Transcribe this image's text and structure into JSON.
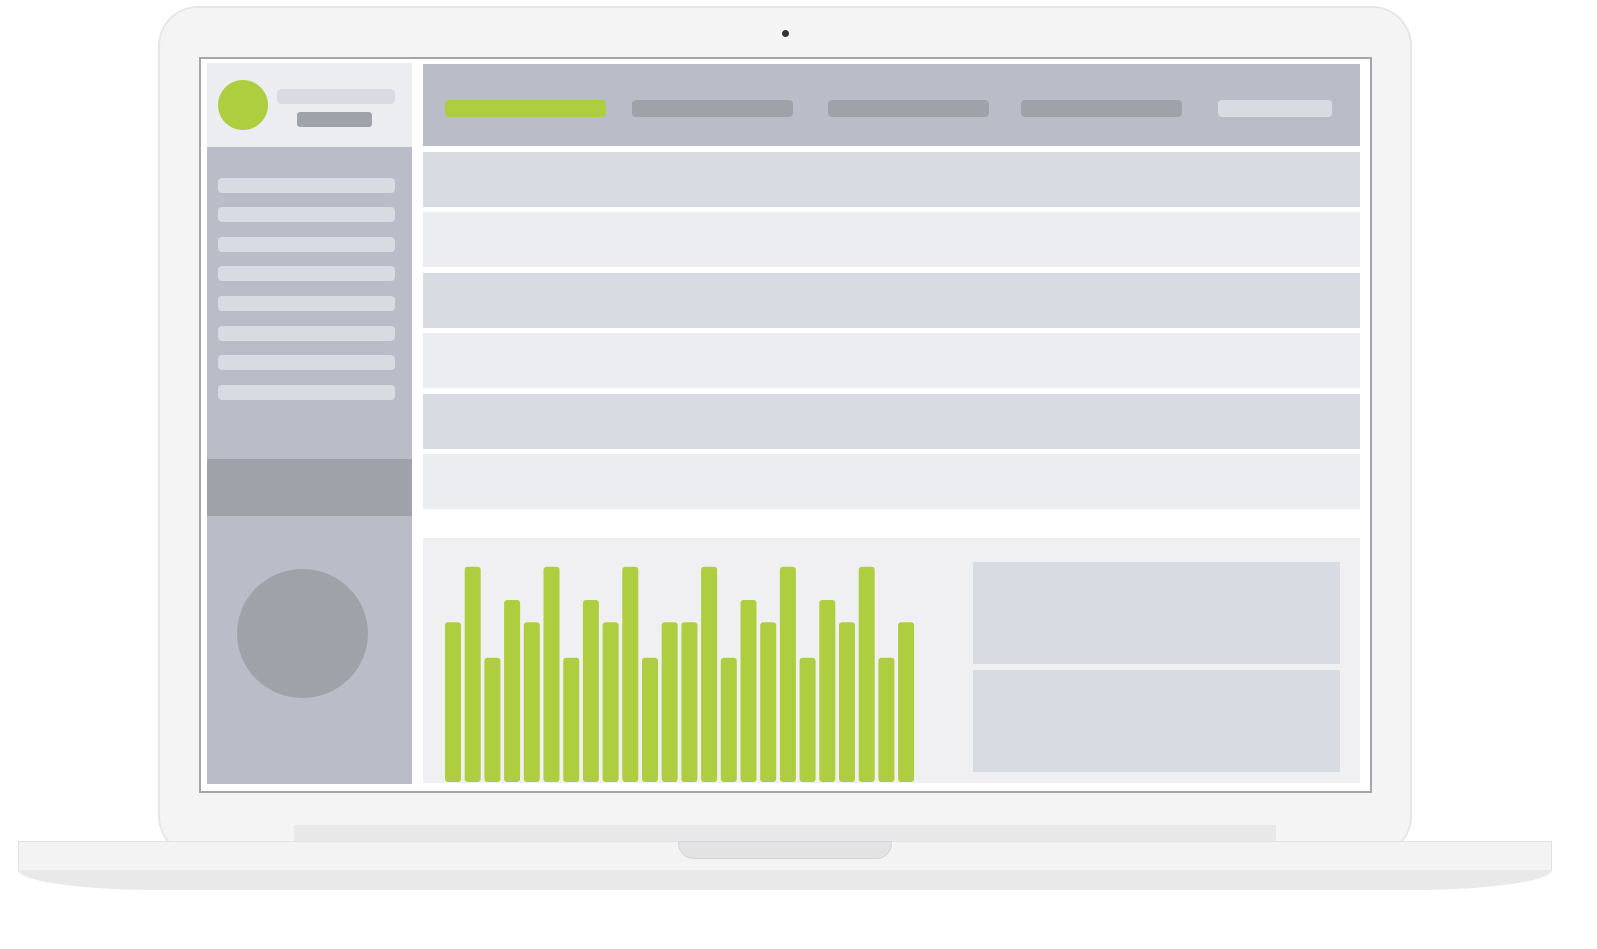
{
  "colors": {
    "accent": "#aecd3f",
    "panel_dark": "#babcc7",
    "panel_mid": "#a0a2aa",
    "row_dark": "#d9dbe2",
    "row_light": "#ecedf0",
    "laptop_body": "#f4f4f5"
  },
  "sidebar": {
    "nav_items": 8
  },
  "tabs": [
    {
      "state": "active"
    },
    {
      "state": "inactive"
    },
    {
      "state": "inactive"
    },
    {
      "state": "inactive"
    },
    {
      "state": "light"
    }
  ],
  "rows": [
    "dark",
    "light",
    "dark",
    "light",
    "dark",
    "light"
  ],
  "chart_data": {
    "type": "bar",
    "title": "",
    "xlabel": "",
    "ylabel": "",
    "ylim": [
      0,
      100
    ],
    "values": [
      72,
      97,
      56,
      82,
      72,
      97,
      56,
      82,
      72,
      97,
      56,
      72,
      72,
      97,
      56,
      82,
      72,
      97,
      56,
      82,
      72,
      97,
      56,
      72
    ]
  }
}
